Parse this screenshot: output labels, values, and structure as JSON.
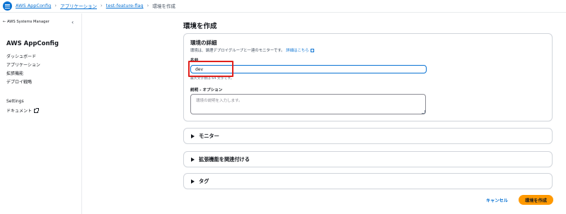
{
  "topbar": {
    "breadcrumbs": [
      {
        "label": "AWS AppConfig"
      },
      {
        "label": "アプリケーション"
      },
      {
        "label": "test-feature-flag"
      }
    ],
    "current": "環境を作成"
  },
  "sidenav": {
    "back_label": "← AWS Systems Manager",
    "title": "AWS AppConfig",
    "items": [
      {
        "label": "ダッシュボード"
      },
      {
        "label": "アプリケーション"
      },
      {
        "label": "拡張機能"
      },
      {
        "label": "デプロイ戦略"
      }
    ],
    "settings_label": "Settings",
    "docs_label": "ドキュメント"
  },
  "main": {
    "page_title": "環境を作成",
    "details": {
      "header": "環境の詳細",
      "description": "環境は、論理デプロイグループと一連のモニターです。",
      "info_link": "詳細はこちら",
      "name_label": "名前",
      "name_value": "dev",
      "name_hint": "最大文字数は 64 文字です。",
      "desc_label": "説明 - オプション",
      "desc_placeholder": "環境の説明を入力します。"
    },
    "sections": {
      "monitor": "モニター",
      "extensions": "拡張機能を関連付ける",
      "tags": "タグ"
    },
    "actions": {
      "cancel": "キャンセル",
      "create": "環境を作成"
    }
  },
  "colors": {
    "link": "#0972d3",
    "primary_button": "#ff9900",
    "highlight": "#e0201c"
  }
}
